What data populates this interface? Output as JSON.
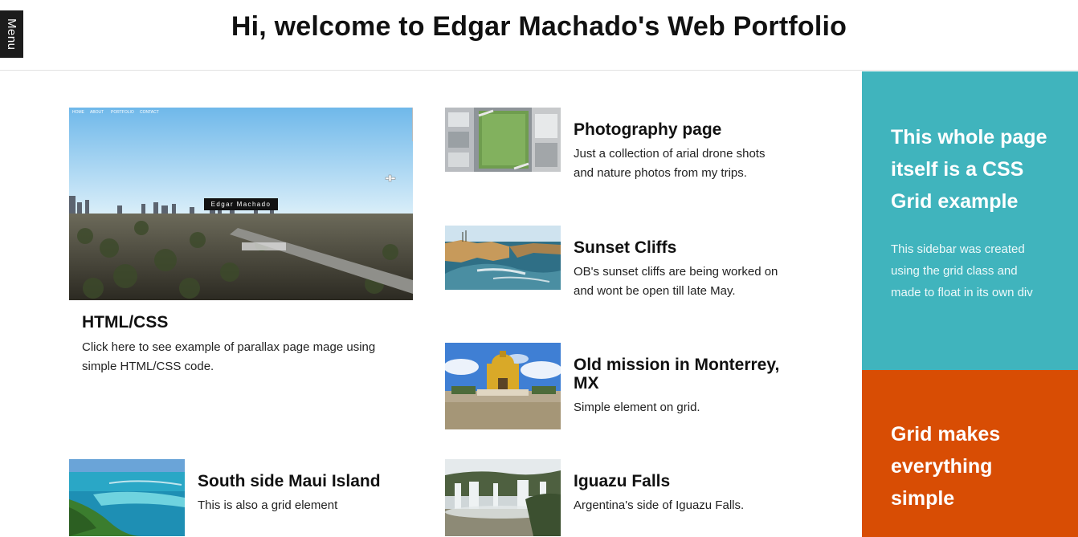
{
  "menu": {
    "label": "Menu"
  },
  "header": {
    "title": "Hi, welcome to Edgar Machado's Web Portfolio"
  },
  "feature": {
    "title": "HTML/CSS",
    "description": "Click here to see example of parallax page mage using simple HTML/CSS code.",
    "preview": {
      "nav_items": [
        "HOME",
        "ABOUT",
        "PORTFOLIO",
        "CONTACT"
      ],
      "name_badge": "Edgar Machado"
    }
  },
  "cards": [
    {
      "title": "Photography page",
      "description": "Just a collection of arial drone shots and nature photos from my trips."
    },
    {
      "title": "Sunset Cliffs",
      "description": "OB's sunset cliffs are being worked on and wont be open till late May."
    },
    {
      "title": "Old mission in Monterrey, MX",
      "description": "Simple element on grid."
    },
    {
      "title": "South side Maui Island",
      "description": "This is also a grid element"
    },
    {
      "title": "Iguazu Falls",
      "description": "Argentina's side of Iguazu Falls."
    }
  ],
  "sidebar": {
    "top_title": "This whole page itself is a CSS Grid example",
    "top_text": "This sidebar was created using the grid class and made to float in its own div",
    "bottom_title": "Grid makes everything simple",
    "colors": {
      "top": "#40b4bd",
      "bottom": "#d84d04"
    }
  }
}
